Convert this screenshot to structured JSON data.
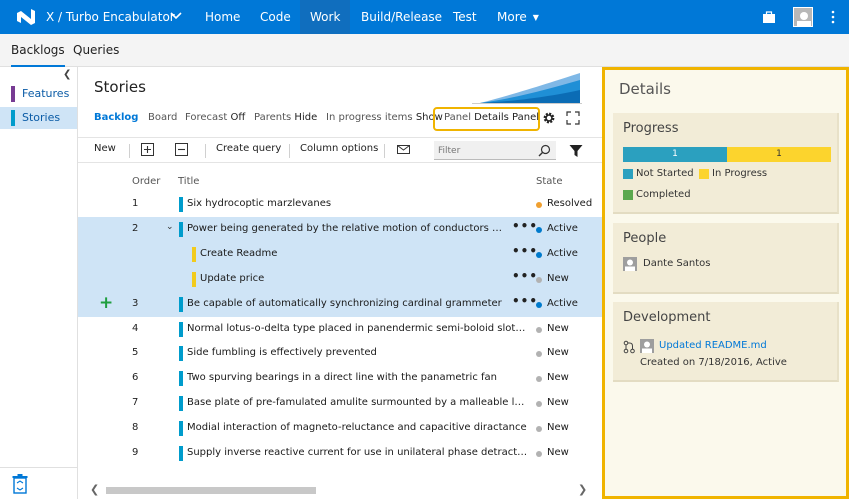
{
  "topbar": {
    "project": "X / Turbo Encabulator",
    "nav": [
      {
        "label": "Home",
        "active": false
      },
      {
        "label": "Code",
        "active": false
      },
      {
        "label": "Work",
        "active": true
      },
      {
        "label": "Build/Release",
        "active": false
      },
      {
        "label": "Test",
        "active": false
      },
      {
        "label": "More",
        "active": false
      }
    ],
    "icons": [
      "vsts-logo-icon",
      "chevron-down-icon",
      "shopping-bag-icon",
      "user-avatar",
      "more-vertical-icon"
    ],
    "color": "#0078d7"
  },
  "subnav": {
    "tabs": [
      {
        "label": "Backlogs",
        "active": true
      },
      {
        "label": "Queries",
        "active": false
      }
    ]
  },
  "leftnav": {
    "items": [
      {
        "label": "Features",
        "color": "#773b93",
        "selected": false
      },
      {
        "label": "Stories",
        "color": "#009ccc",
        "selected": true
      }
    ]
  },
  "main": {
    "title": "Stories",
    "pivots": {
      "backlog": "Backlog",
      "board": "Board",
      "forecast_label": "Forecast",
      "forecast_value": "Off",
      "parents_label": "Parents",
      "parents_value": "Hide",
      "inprogress_label": "In progress items",
      "inprogress_value": "Show",
      "panel_label": "Panel",
      "panel_value": "Details Panel"
    },
    "toolbar": {
      "new": "New",
      "create_query": "Create query",
      "column_options": "Column options",
      "filter_placeholder": "Filter"
    },
    "columns": {
      "order": "Order",
      "title": "Title",
      "state": "State"
    },
    "rows": [
      {
        "order": "1",
        "title": "Six hydrocoptic marzlevanes",
        "state": "Resolved",
        "child": false,
        "selected": false
      },
      {
        "order": "2",
        "title": "Power being generated by the relative motion of conductors and...",
        "state": "Active",
        "child": false,
        "selected": true,
        "expander": "⌄"
      },
      {
        "order": "",
        "title": "Create Readme",
        "state": "Active",
        "child": true,
        "selected": true
      },
      {
        "order": "",
        "title": "Update price",
        "state": "New",
        "child": true,
        "selected": true
      },
      {
        "order": "3",
        "title": "Be capable of automatically synchronizing cardinal grammeter",
        "state": "Active",
        "child": false,
        "selected": true,
        "plus": "+"
      },
      {
        "order": "4",
        "title": "Normal lotus-o-delta type placed in panendermic semi-boloid slots of...",
        "state": "New",
        "child": false,
        "selected": false
      },
      {
        "order": "5",
        "title": "Side fumbling is effectively prevented",
        "state": "New",
        "child": false,
        "selected": false
      },
      {
        "order": "6",
        "title": "Two spurving bearings in a direct line with the panametric fan",
        "state": "New",
        "child": false,
        "selected": false
      },
      {
        "order": "7",
        "title": "Base plate of pre-famulated amulite surmounted by a malleable logari...",
        "state": "New",
        "child": false,
        "selected": false
      },
      {
        "order": "8",
        "title": "Modial interaction of magneto-reluctance and capacitive diractance",
        "state": "New",
        "child": false,
        "selected": false
      },
      {
        "order": "9",
        "title": "Supply inverse reactive current for use in unilateral phase detractors",
        "state": "New",
        "child": false,
        "selected": false
      }
    ],
    "state_colors": {
      "Resolved": "#f0a030",
      "Active": "#007acc",
      "New": "#b2b2b2"
    },
    "story_color": "#009ccc",
    "task_color": "#f2cb1d",
    "dots": "•••"
  },
  "details": {
    "title": "Details",
    "progress": {
      "title": "Progress",
      "segments": [
        {
          "label": "1",
          "color": "#2ba0bf",
          "fraction": 0.5
        },
        {
          "label": "1",
          "color": "#fcd42d",
          "fraction": 0.5
        }
      ],
      "legend": [
        {
          "label": "Not Started",
          "color": "#2ba0bf"
        },
        {
          "label": "In Progress",
          "color": "#fcd42d"
        },
        {
          "label": "Completed",
          "color": "#5ba84f"
        }
      ]
    },
    "people": {
      "title": "People",
      "name": "Dante Santos"
    },
    "development": {
      "title": "Development",
      "link": "Updated README.md",
      "meta": "Created on 7/18/2016,  Active"
    },
    "highlight_color": "#f0b400"
  }
}
